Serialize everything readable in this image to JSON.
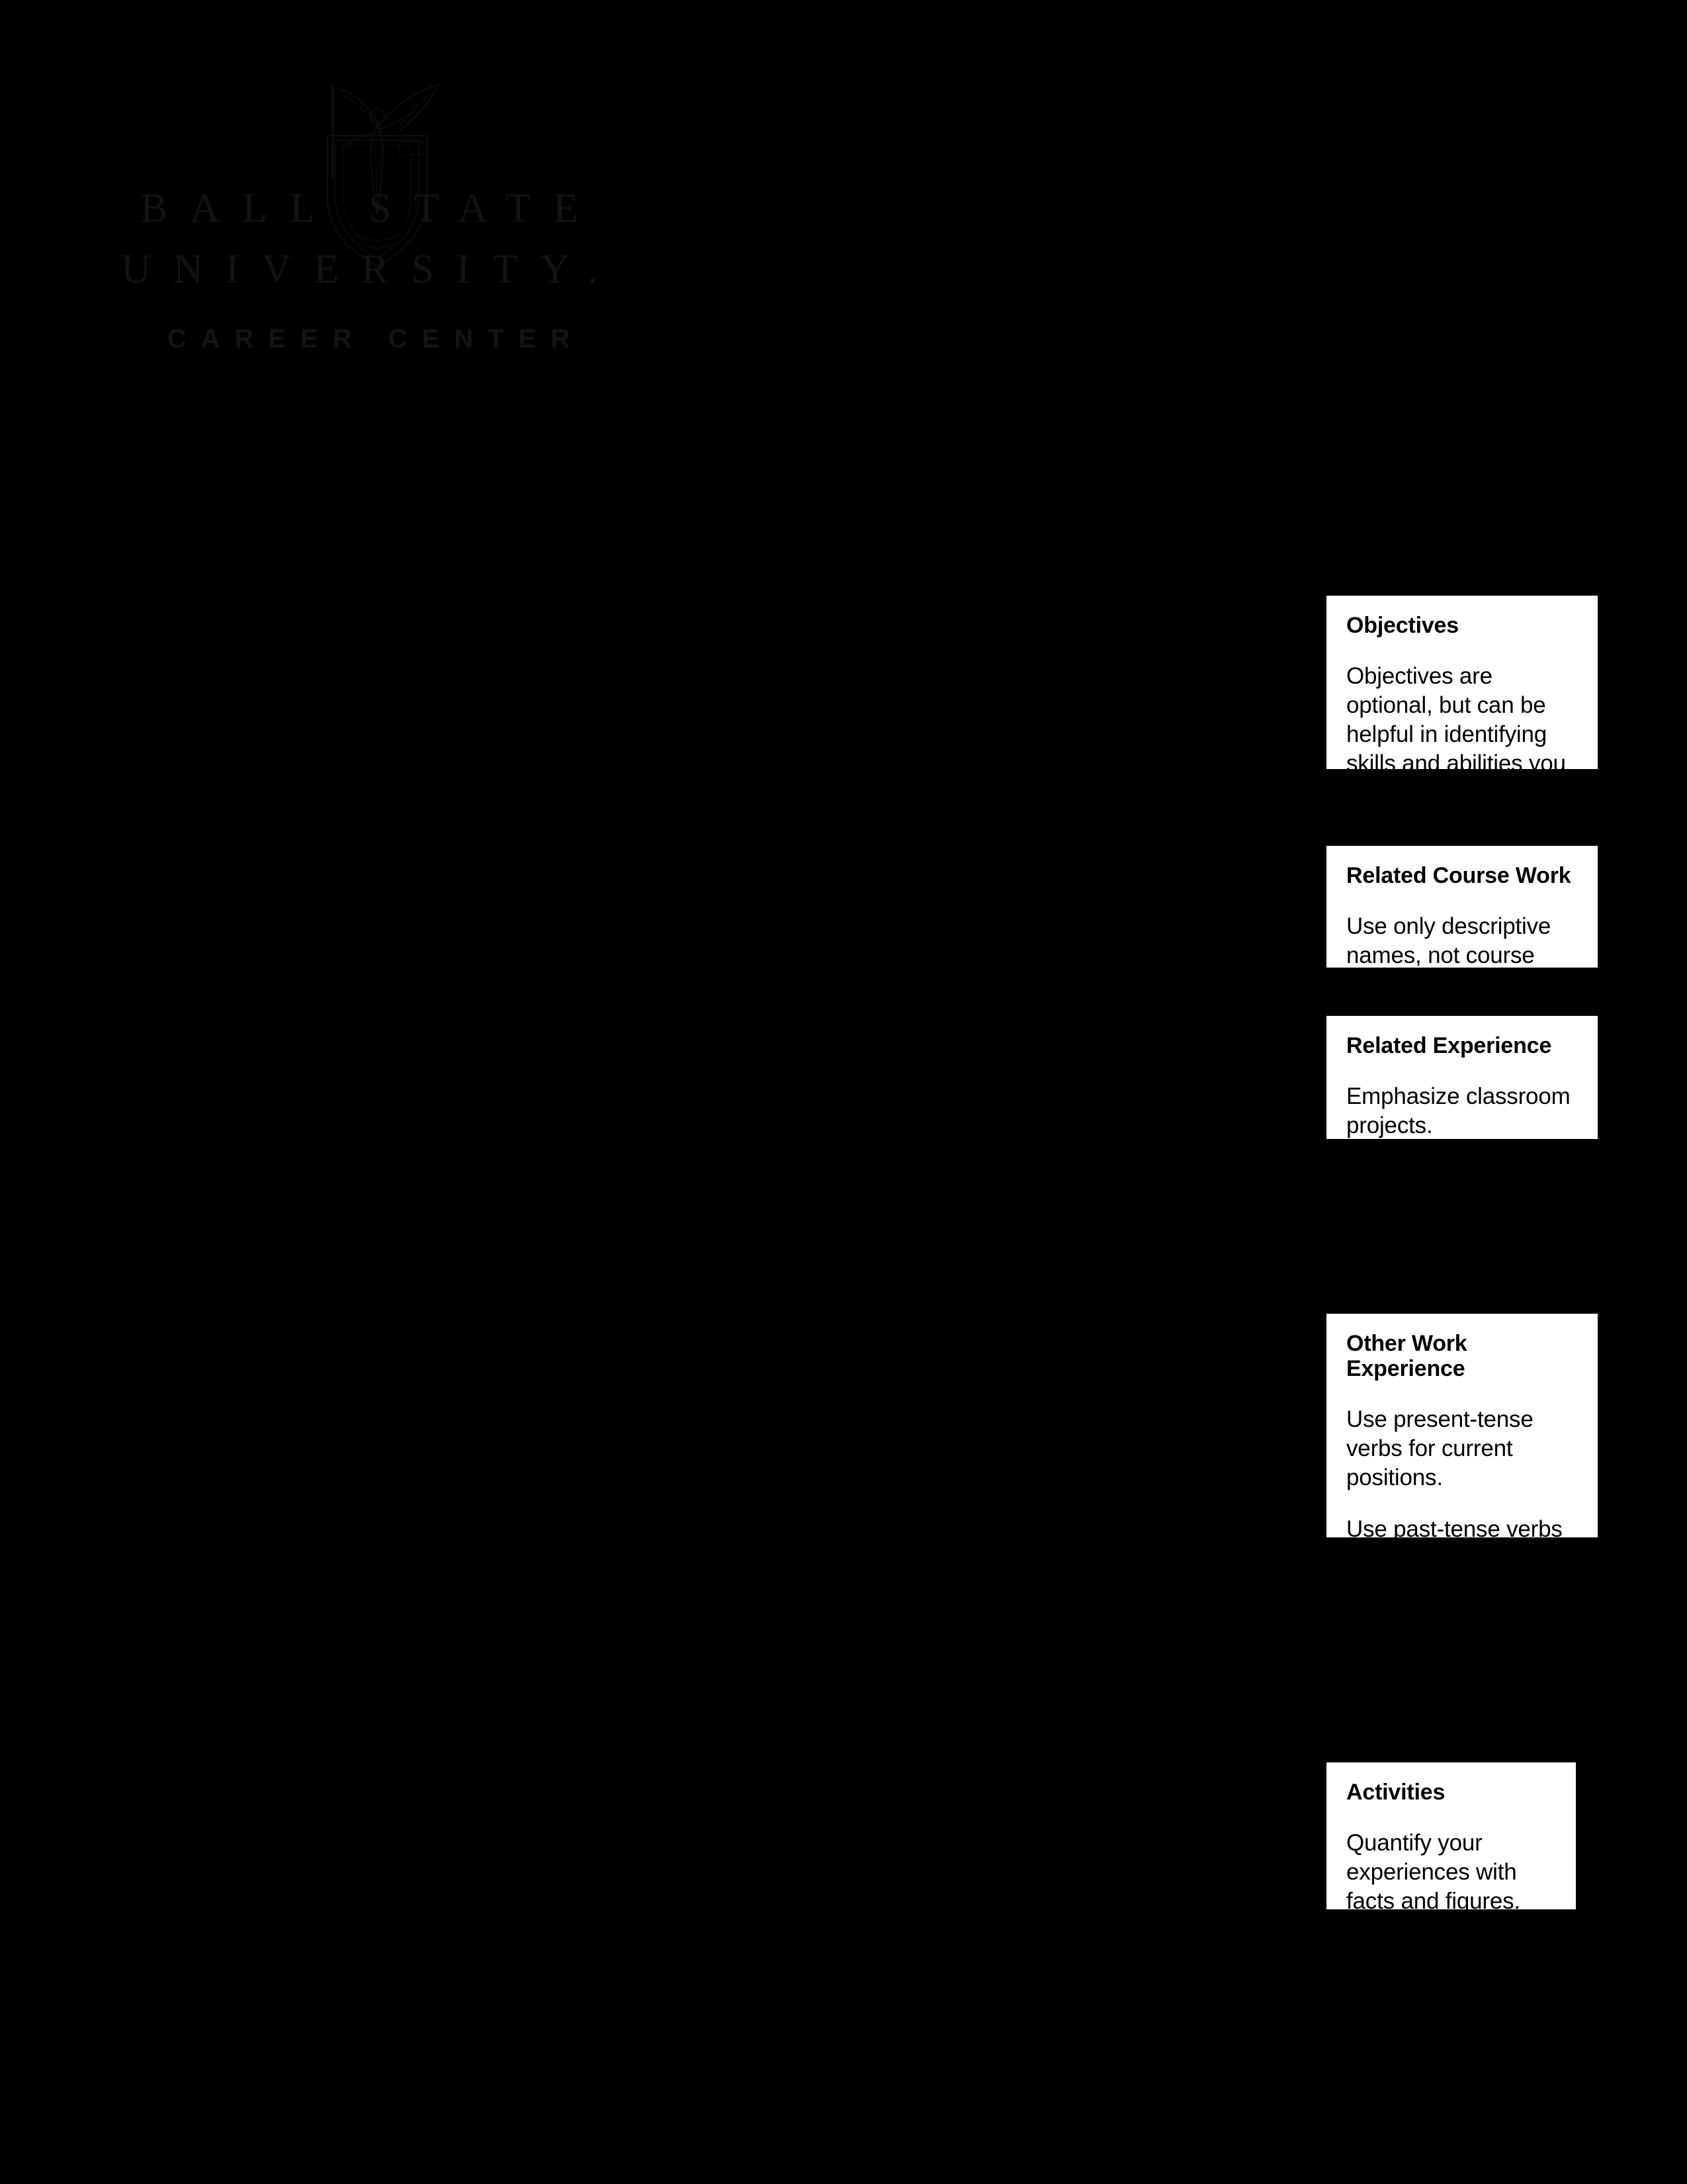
{
  "page": {
    "background_color": "#000000",
    "text_color": "#000000",
    "callout_background": "#ffffff"
  },
  "logo": {
    "emblem_name": "ball-state-cardinal-crest-emblem",
    "line_1": "BALL STATE",
    "line_2": "UNIVERSITY.",
    "line_3": "CAREER CENTER"
  },
  "callouts": [
    {
      "id": "objectives",
      "title": "Objectives",
      "paragraphs": [
        "Objectives are optional, but can be helpful in identifying skills and abilities you have to offer an employer if hired."
      ]
    },
    {
      "id": "related-course-work",
      "title": "Related Course Work",
      "paragraphs": [
        "Use only descriptive names, not course numbers."
      ]
    },
    {
      "id": "related-experience",
      "title": "Related Experience",
      "paragraphs": [
        "Emphasize classroom projects."
      ]
    },
    {
      "id": "other-work-experience",
      "title": "Other Work Experience",
      "paragraphs": [
        "Use present-tense verbs for current positions.",
        "Use past-tense verbs for previous positions."
      ]
    },
    {
      "id": "activities",
      "title": "Activities",
      "paragraphs": [
        "Quantify your experiences with facts and figures."
      ]
    }
  ]
}
